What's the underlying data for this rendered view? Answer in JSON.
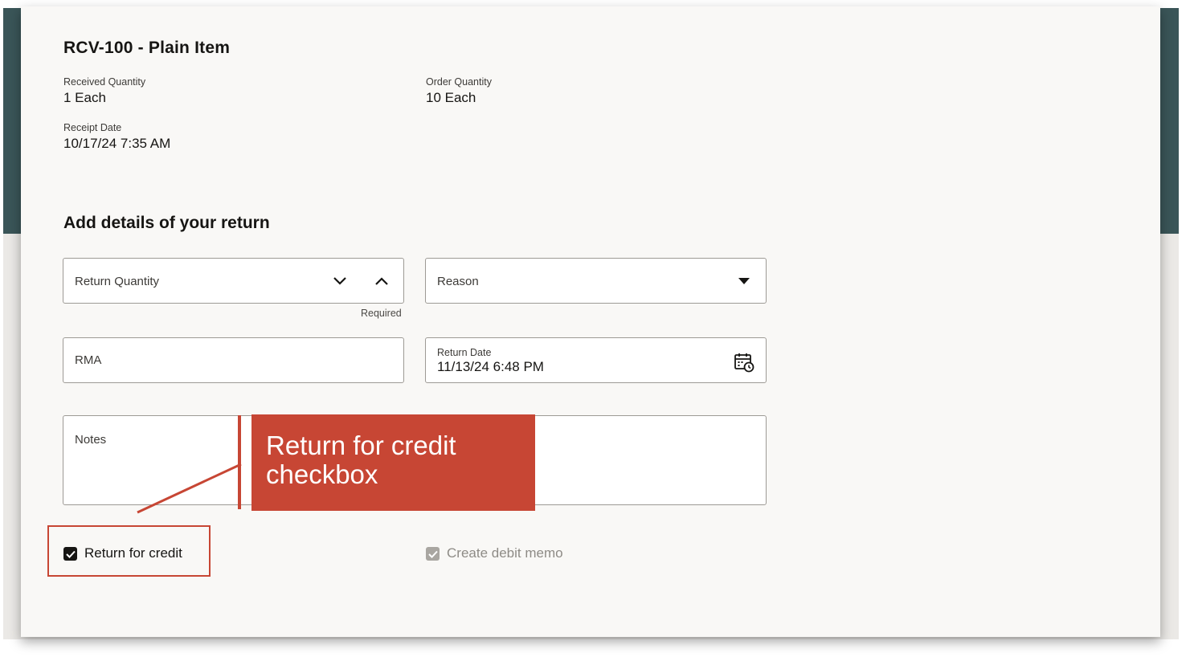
{
  "item": {
    "title": "RCV-100 - Plain Item",
    "received_quantity_label": "Received Quantity",
    "received_quantity_value": "1 Each",
    "order_quantity_label": "Order Quantity",
    "order_quantity_value": "10 Each",
    "receipt_date_label": "Receipt Date",
    "receipt_date_value": "10/17/24 7:35 AM"
  },
  "form": {
    "section_title": "Add details of your return",
    "return_quantity_placeholder": "Return Quantity",
    "return_quantity_helper": "Required",
    "reason_placeholder": "Reason",
    "rma_placeholder": "RMA",
    "return_date_label": "Return Date",
    "return_date_value": "11/13/24 6:48 PM",
    "notes_placeholder": "Notes",
    "return_for_credit_label": "Return for credit",
    "return_for_credit_checked": true,
    "create_debit_memo_label": "Create debit memo",
    "create_debit_memo_checked": true,
    "create_debit_memo_disabled": true
  },
  "annotation": {
    "callout_line1": "Return for credit",
    "callout_line2": "checkbox",
    "accent_color": "#c74634"
  },
  "icons": [
    "chevron-down-icon",
    "chevron-up-icon",
    "caret-down-icon",
    "calendar-clock-icon",
    "checkmark-icon"
  ]
}
